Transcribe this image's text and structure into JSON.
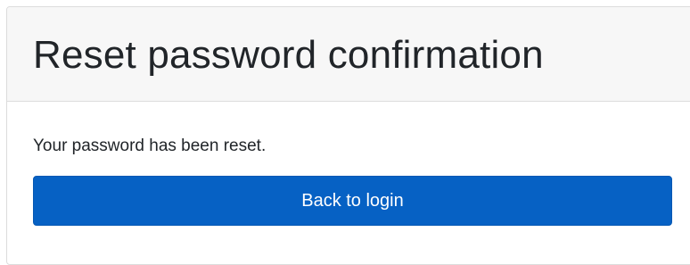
{
  "header": {
    "title": "Reset password confirmation"
  },
  "body": {
    "message": "Your password has been reset.",
    "back_button_label": "Back to login"
  },
  "colors": {
    "primary": "#0661c4",
    "header_bg": "#f7f7f7",
    "text": "#212529"
  }
}
